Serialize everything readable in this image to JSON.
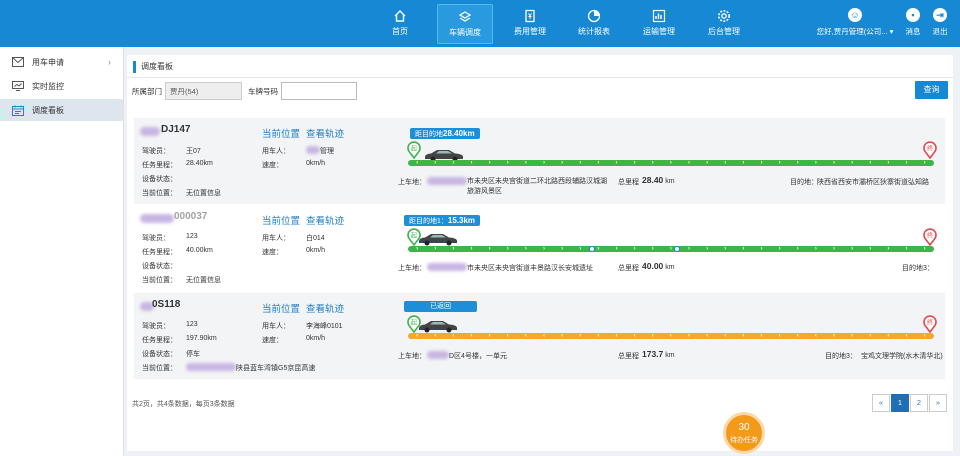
{
  "topnav": [
    {
      "label": "首页",
      "icon": "home-icon"
    },
    {
      "label": "车辆调度",
      "icon": "layers-icon"
    },
    {
      "label": "费用管理",
      "icon": "document-yen-icon"
    },
    {
      "label": "统计报表",
      "icon": "pie-chart-icon"
    },
    {
      "label": "运输管理",
      "icon": "bar-chart-icon"
    },
    {
      "label": "后台管理",
      "icon": "gear-icon"
    }
  ],
  "user": {
    "label": "您好,贾丹管理(公司...",
    "messages": "消息",
    "logout": "退出"
  },
  "sidebar": [
    {
      "label": "用车申请",
      "icon": "mail-icon"
    },
    {
      "label": "实时监控",
      "icon": "monitor-icon"
    },
    {
      "label": "调度看板",
      "icon": "calendar-icon"
    }
  ],
  "main": {
    "title": "调度看板",
    "dept_label": "所属部门",
    "dept_value": "贾丹(54)",
    "plate_label": "车牌号码",
    "plate_value": "",
    "query_button": "查询"
  },
  "labels": {
    "driver": "驾驶员：",
    "mileage": "任务里程：",
    "device": "设备状态：",
    "location": "当前位置：",
    "user": "用车人：",
    "speed": "速度：",
    "cur_pos": "当前位置",
    "track": "查看轨迹",
    "start": "上车地：",
    "total": "总里程",
    "dest": "目的地：",
    "start_pin": "起",
    "end_pin": "终"
  },
  "vehicles": [
    {
      "plate": "DJ147",
      "driver": "王07",
      "mileage": "28.40km",
      "device": "",
      "location": "无位置信息",
      "user": "管理",
      "speed": "0km/h",
      "pill_text": "距目的地",
      "pill_value": "28.40km",
      "start": "市未央区未央宫街道二环北路西段辅路汉城湖旅游风景区",
      "total": "28.40",
      "total_unit": "km",
      "dest": "陕西省西安市灞桥区狄寨街道弘知路",
      "track_color": "#3cb54a",
      "progress": 0
    },
    {
      "plate": "000037",
      "driver": "123",
      "mileage": "40.00km",
      "device": "",
      "location": "无位置信息",
      "user": "白014",
      "speed": "0km/h",
      "pill_text": "距目的地1：",
      "pill_value": "15.3km",
      "start": "市未央区未央宫街道丰景路汉长安城遗址",
      "total": "40.00",
      "total_unit": "km",
      "dest": "目的地3：",
      "track_color": "#3cb54a",
      "progress": 0
    },
    {
      "plate": "0S118",
      "driver": "123",
      "mileage": "197.90km",
      "device": "停车",
      "location": "陕县蓝车湾镇G5京昆高速",
      "user": "李海峰0101",
      "speed": "0km/h",
      "pill_text": "已返回",
      "pill_value": "",
      "start": "D区4号楼，一单元",
      "total": "173.7",
      "total_unit": "km",
      "dest": "宝鸡文理学院(水木清华北)",
      "track_color": "#f7a829",
      "progress": 1
    }
  ],
  "footer": "共2页，共4条数据，每页3条数据",
  "pagination": [
    "«",
    "1",
    "2",
    "»"
  ],
  "todo": {
    "count": "30",
    "label": "待办任务"
  }
}
